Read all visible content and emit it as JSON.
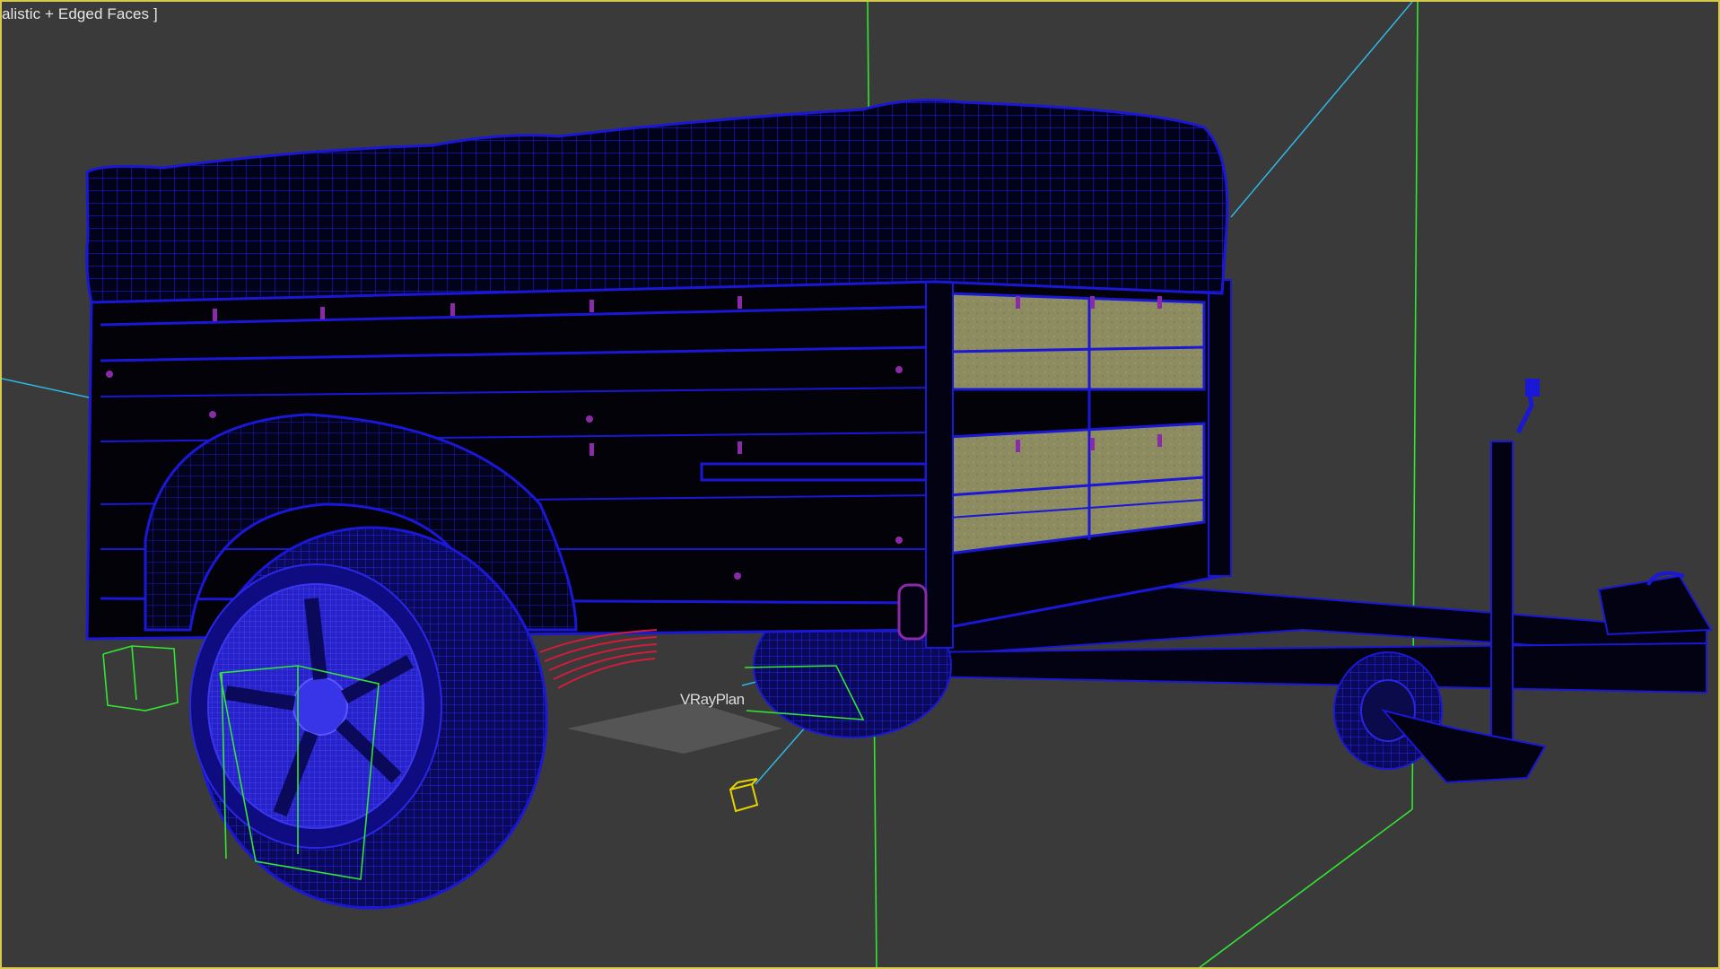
{
  "viewport": {
    "label": "alistic + Edged Faces ]",
    "active_border_color": "#d8c84a",
    "background_color": "#3a3a3a"
  },
  "scene": {
    "light_label": "VRayPlan",
    "wireframe_color": "#1a17d6",
    "selection_box_color": "#32e632",
    "light_color": "#e6d200",
    "target_line_color": "#2fb8e6",
    "spring_color": "#d21c3c",
    "bolt_color": "#8a2aa6",
    "side_panel_color": "#8f8f62"
  }
}
